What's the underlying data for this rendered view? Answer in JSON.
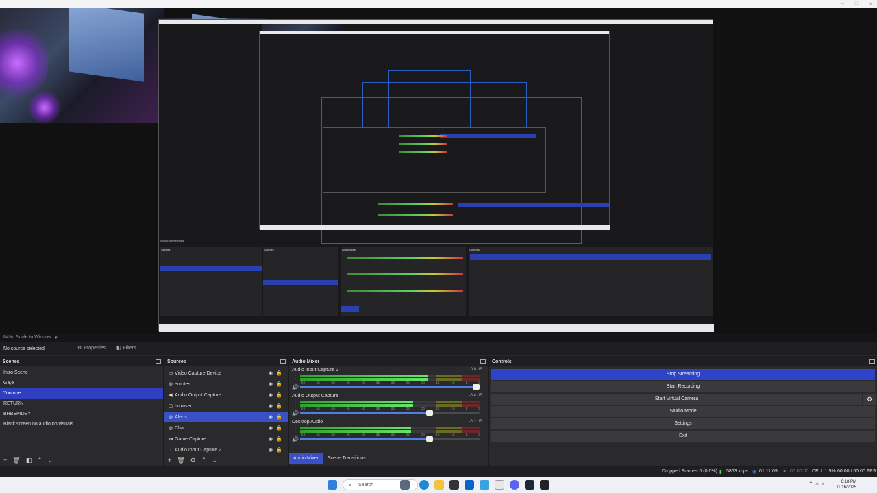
{
  "preview": {
    "nested_labels": {
      "no_source": "No source selected",
      "scale_label": "Scale to Window",
      "properties": "Properties",
      "filters": "Filters",
      "scenes": "Scenes",
      "sources": "Sources",
      "audio_mixer": "Audio Mixer",
      "controls": "Controls",
      "scene_items": [
        "Intro Scene",
        "Ga,e",
        "Youtube",
        "RETURN",
        "BRBSPIDEY",
        "Black screen no audio no visuals"
      ],
      "source_items": [
        "Video Capture Device",
        "emotes",
        "Audio Output Capture",
        "browser",
        "Alerts",
        "Chat",
        "Game Capture",
        "Audio Input Capture 2"
      ],
      "controls_items": [
        "Stop Streaming",
        "Start Recording",
        "Start Virtual Camera",
        "Studio Mode",
        "Settings",
        "Exit"
      ],
      "tab_mixer": "Audio Mixer",
      "tab_transitions": "Scene Transitions",
      "status_text": "Dropped Frames 0 (0.0%)   5863 kbps   01:11:09   00:00:00   CPU: 1.5%   60.00 / 60.00 FPS"
    }
  },
  "strip": {
    "left": "84%",
    "scale": "Scale to Window"
  },
  "context_bar": {
    "no_source": "No source selected",
    "properties": "Properties",
    "filters": "Filters"
  },
  "scenes": {
    "title": "Scenes",
    "items": [
      "Intro Scene",
      "Ga,e",
      "Youtube",
      "RETURN",
      "BRBSPIDEY",
      "Black screen no audio no visuals"
    ],
    "selected": "Youtube"
  },
  "sources": {
    "title": "Sources",
    "items": [
      {
        "label": "Video Capture Device",
        "icon": "camera-icon"
      },
      {
        "label": "emotes",
        "icon": "globe-icon"
      },
      {
        "label": "Audio Output Capture",
        "icon": "speaker-icon"
      },
      {
        "label": "browser",
        "icon": "window-icon"
      },
      {
        "label": "Alerts",
        "icon": "globe-icon"
      },
      {
        "label": "Chat",
        "icon": "globe-icon"
      },
      {
        "label": "Game Capture",
        "icon": "gamepad-icon"
      },
      {
        "label": "Audio Input Capture 2",
        "icon": "microphone-icon"
      }
    ],
    "selected": "Alerts"
  },
  "mixer": {
    "title": "Audio Mixer",
    "channels": [
      {
        "name": "Audio Input Capture 2",
        "db": "0.0 dB",
        "level": 0.71,
        "volume": 1.0
      },
      {
        "name": "Audio Output Capture",
        "db": "-6.4 dB",
        "level": 0.63,
        "volume": 0.74
      },
      {
        "name": "Desktop Audio",
        "db": "-6.2 dB",
        "level": 0.62,
        "volume": 0.74
      }
    ],
    "ticks": [
      "-60",
      "-55",
      "-50",
      "-45",
      "-40",
      "-35",
      "-30",
      "-25",
      "-20",
      "-15",
      "-10",
      "-5",
      "0"
    ],
    "tabs": [
      "Audio Mixer",
      "Scene Transitions"
    ]
  },
  "controls": {
    "title": "Controls",
    "buttons": [
      "Stop Streaming",
      "Start Recording",
      "Start Virtual Camera",
      "Studio Mode",
      "Settings",
      "Exit"
    ]
  },
  "status": {
    "dropped": "Dropped Frames 0 (0.0%)",
    "kbps": "5863 kbps",
    "stream_time": "01:11:09",
    "rec_time": "00:00:00",
    "cpu": "CPU: 1.5%",
    "fps": "60.00 / 60.00 FPS"
  },
  "taskbar": {
    "search_placeholder": "Search",
    "time": "6:18 PM",
    "date": "11/16/2025"
  },
  "colors": {
    "accent": "#2e44c8",
    "selection": "#3a51c6",
    "panel": "#2a2a2c",
    "meter_green": "#5fd05f",
    "meter_yellow": "#c8c83a",
    "meter_red": "#c43a3a"
  }
}
